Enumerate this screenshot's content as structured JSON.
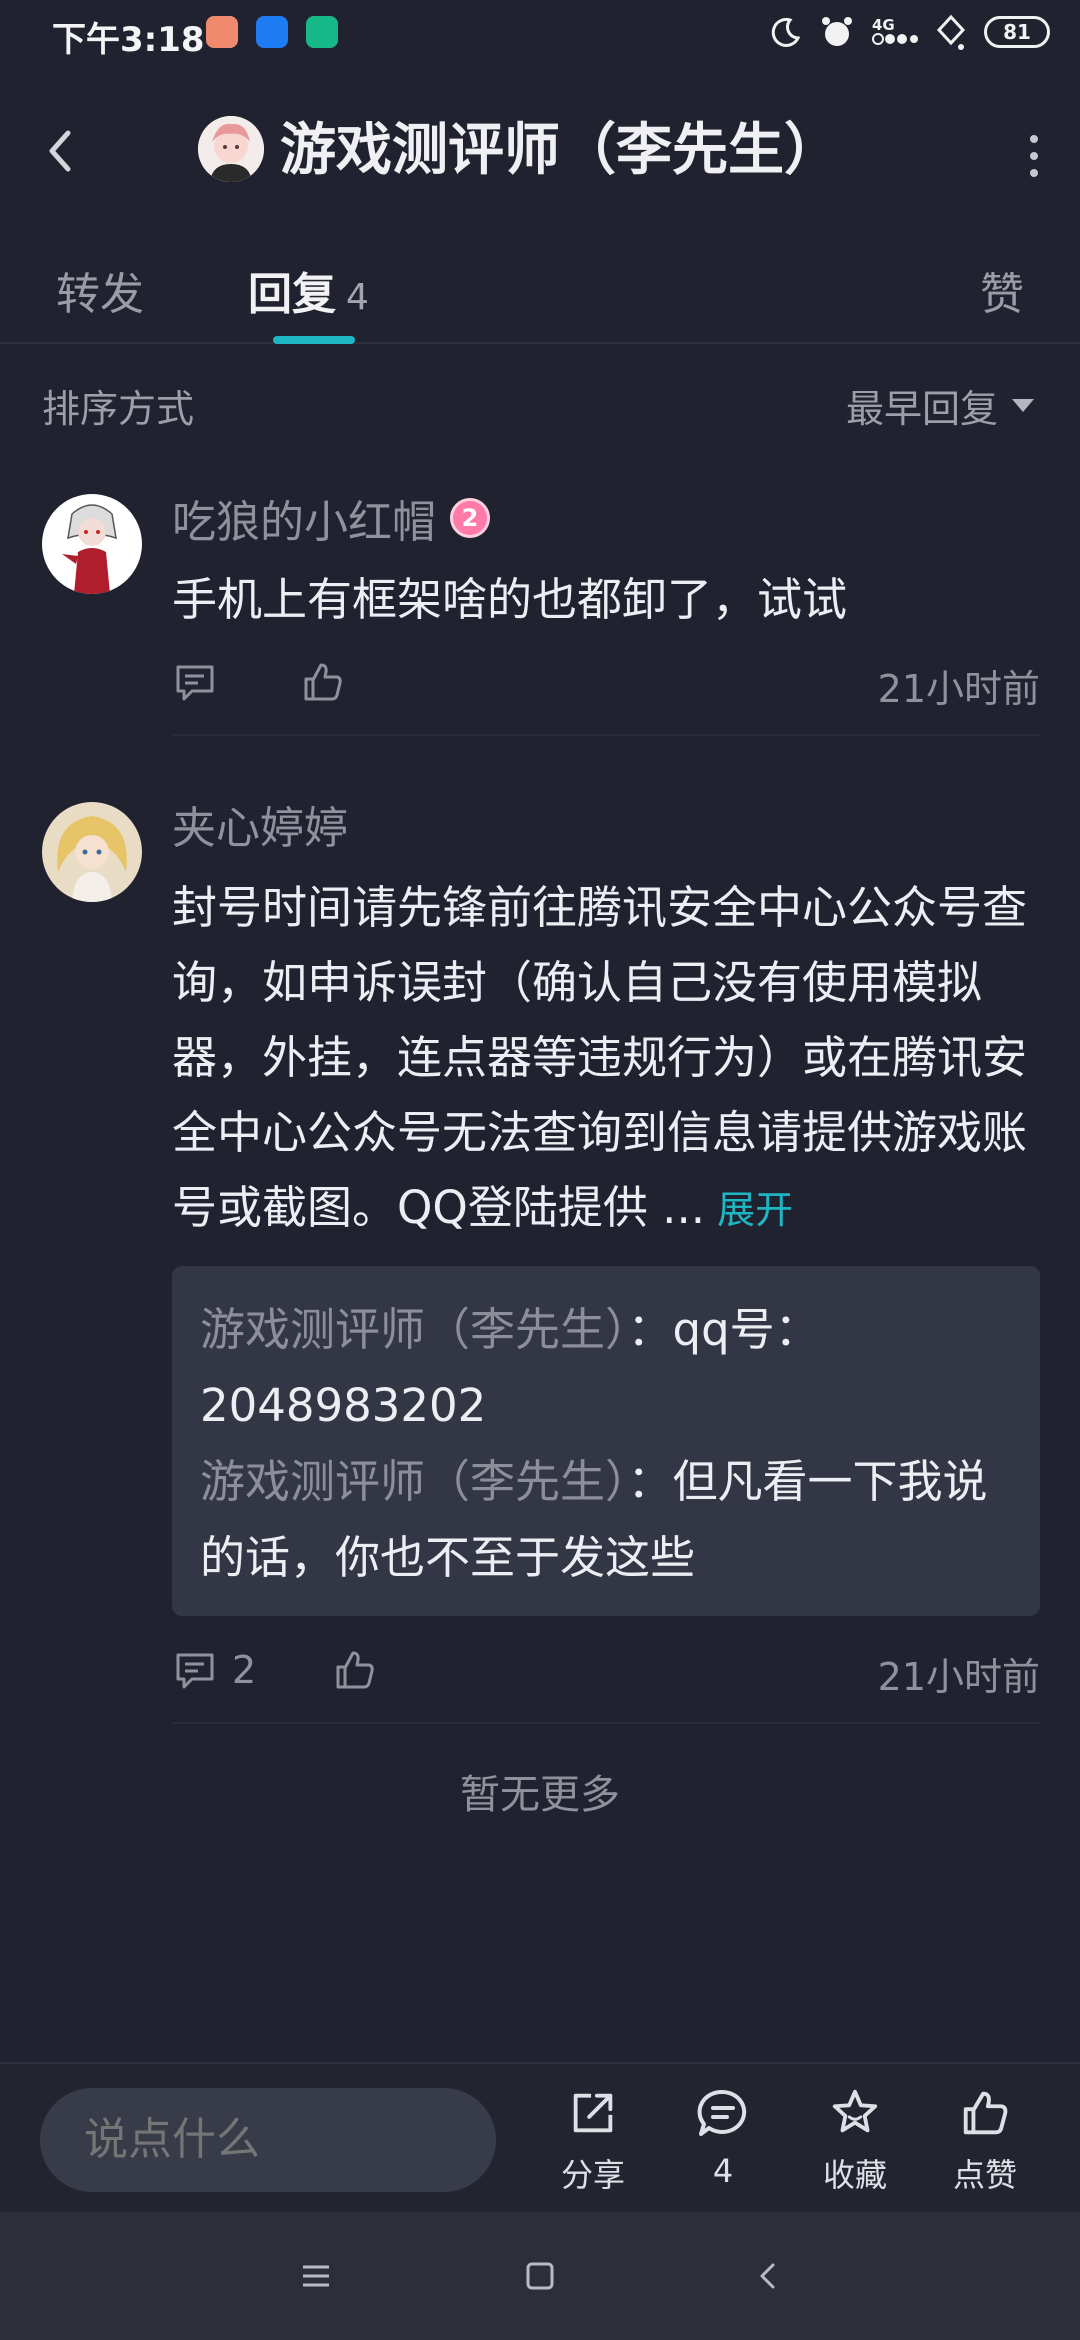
{
  "status_bar": {
    "time": "下午3:18",
    "network": "4G",
    "battery": "81",
    "app_icon_colors": [
      "#f08a6e",
      "#1e7cf2",
      "#16b888"
    ]
  },
  "header": {
    "title": "游戏测评师（李先生）",
    "back_icon": "chevron-left-icon",
    "more_icon": "more-vertical-icon"
  },
  "tabs": {
    "repost": "转发",
    "reply": "回复",
    "reply_count": "4",
    "like": "赞",
    "accent_color": "#1fb6c4"
  },
  "sort": {
    "label": "排序方式",
    "value": "最早回复"
  },
  "comments": [
    {
      "name": "吃狼的小红帽",
      "badge": "2",
      "text": "手机上有框架啥的也都卸了，试试",
      "time": "21小时前"
    },
    {
      "name": "夹心婷婷",
      "text": "封号时间请先锋前往腾讯安全中心公众号查询，如申诉误封（确认自己没有使用模拟器，外挂，连点器等违规行为）或在腾讯安全中心公众号无法查询到信息请提供游戏账号或截图。QQ登陆提供 ...",
      "expand": "展开",
      "quotes": [
        {
          "name": "游戏测评师（李先生）",
          "text": "：qq号：2048983202"
        },
        {
          "name": "游戏测评师（李先生）",
          "text": "：但凡看一下我说的话，你也不至于发这些"
        }
      ],
      "reply_count": "2",
      "time": "21小时前"
    }
  ],
  "no_more": "暂无更多",
  "bottom_bar": {
    "input_placeholder": "说点什么",
    "share": "分享",
    "comment_count": "4",
    "favorite": "收藏",
    "like": "点赞"
  }
}
